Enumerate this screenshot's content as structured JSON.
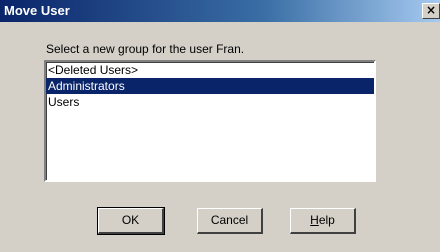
{
  "window": {
    "title": "Move User",
    "close_glyph": "×"
  },
  "prompt": "Select a new group for the user Fran.",
  "groups": {
    "items": [
      "<Deleted Users>",
      "Administrators",
      "Users"
    ],
    "selected_index": 1
  },
  "buttons": {
    "ok": "OK",
    "cancel": "Cancel",
    "help_prefix": "H",
    "help_rest": "elp"
  }
}
